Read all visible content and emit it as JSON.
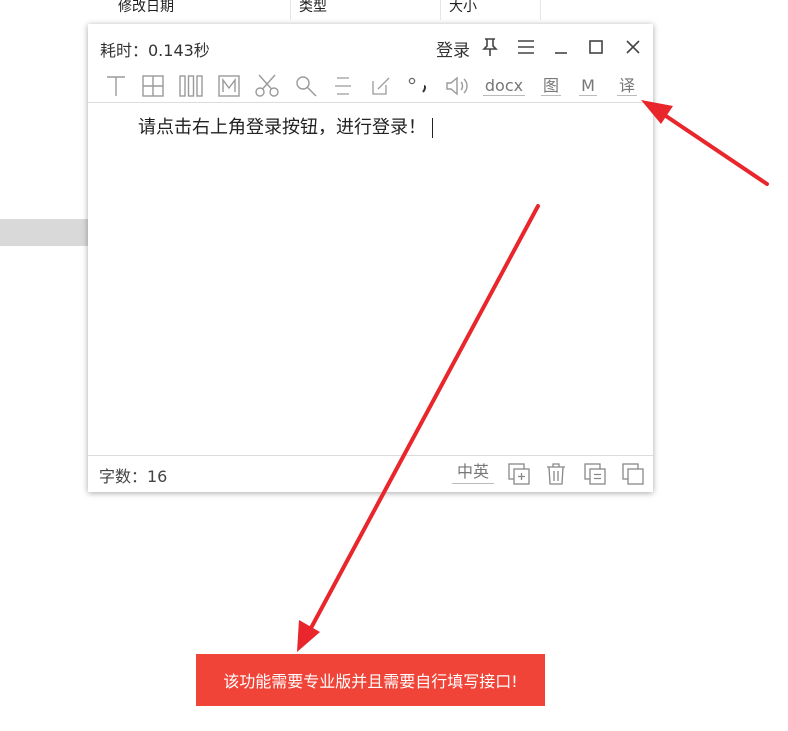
{
  "background": {
    "columns": [
      "修改日期",
      "类型",
      "大小"
    ]
  },
  "window": {
    "elapsed_label": "耗时：0.143秒",
    "login_label": "登录",
    "toolbar": {
      "docx_label": "docx",
      "image_label": "图",
      "m_label": "M",
      "translate_label": "译"
    },
    "editor_text": "请点击右上角登录按钮，进行登录！",
    "status": {
      "word_count_label": "字数：16",
      "lang_label": "中英"
    }
  },
  "toast": {
    "message": "该功能需要专业版并且需要自行填写接口!"
  },
  "colors": {
    "arrow": "#e8262b",
    "toast": "#f04438"
  }
}
